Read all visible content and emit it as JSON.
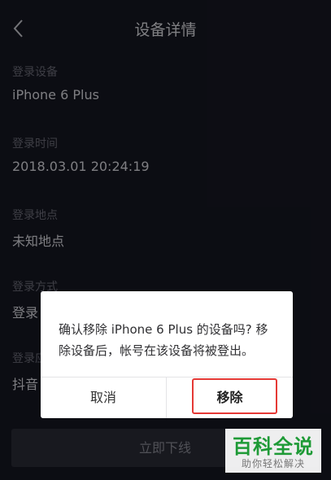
{
  "header": {
    "title": "设备详情",
    "back_icon": "chevron-left-icon"
  },
  "fields": [
    {
      "label": "登录设备",
      "value": "iPhone 6 Plus"
    },
    {
      "label": "登录时间",
      "value": "2018.03.01 20:24:19"
    },
    {
      "label": "登录地点",
      "value": "未知地点"
    },
    {
      "label": "登录方式",
      "value": "登录"
    },
    {
      "label": "登录应",
      "value": "抖音"
    }
  ],
  "offline_button": "立即下线",
  "dialog": {
    "message": "确认移除 iPhone 6 Plus 的设备吗? 移除设备后，帐号在该设备将被登出。",
    "cancel_label": "取消",
    "remove_label": "移除"
  },
  "watermark": {
    "main": "百科全说",
    "sub": "助你轻松解决"
  },
  "colors": {
    "background": "#161722",
    "dialog": "#ffffff",
    "highlight": "#e53935",
    "watermark_green": "#1e9a36"
  }
}
